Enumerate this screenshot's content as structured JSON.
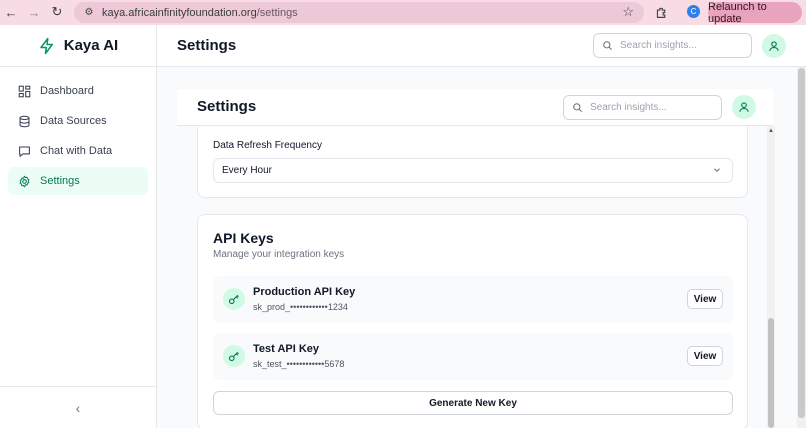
{
  "browser": {
    "url_host": "kaya.africainfinityfoundation.org",
    "url_path": "/settings",
    "profile_initial": "C",
    "relaunch_label": "Relaunch to update"
  },
  "sidebar": {
    "brand": "Kaya AI",
    "items": [
      {
        "label": "Dashboard",
        "icon": "dashboard-icon"
      },
      {
        "label": "Data Sources",
        "icon": "database-icon"
      },
      {
        "label": "Chat with Data",
        "icon": "chat-icon"
      },
      {
        "label": "Settings",
        "icon": "gear-icon",
        "active": true
      }
    ],
    "collapse_icon": "chevron-left-icon"
  },
  "header": {
    "title": "Settings",
    "search_placeholder": "Search insights..."
  },
  "inner_header": {
    "title": "Settings",
    "search_placeholder": "Search insights..."
  },
  "refresh": {
    "label": "Data Refresh Frequency",
    "value": "Every Hour"
  },
  "api_keys": {
    "title": "API Keys",
    "subtitle": "Manage your integration keys",
    "keys": [
      {
        "name": "Production API Key",
        "value": "sk_prod_••••••••••••1234",
        "action": "View"
      },
      {
        "name": "Test API Key",
        "value": "sk_test_••••••••••••5678",
        "action": "View"
      }
    ],
    "generate_label": "Generate New Key"
  },
  "colors": {
    "accent": "#047857",
    "accent_bg": "#ecfdf5",
    "chrome_bg": "#f7dce6"
  }
}
